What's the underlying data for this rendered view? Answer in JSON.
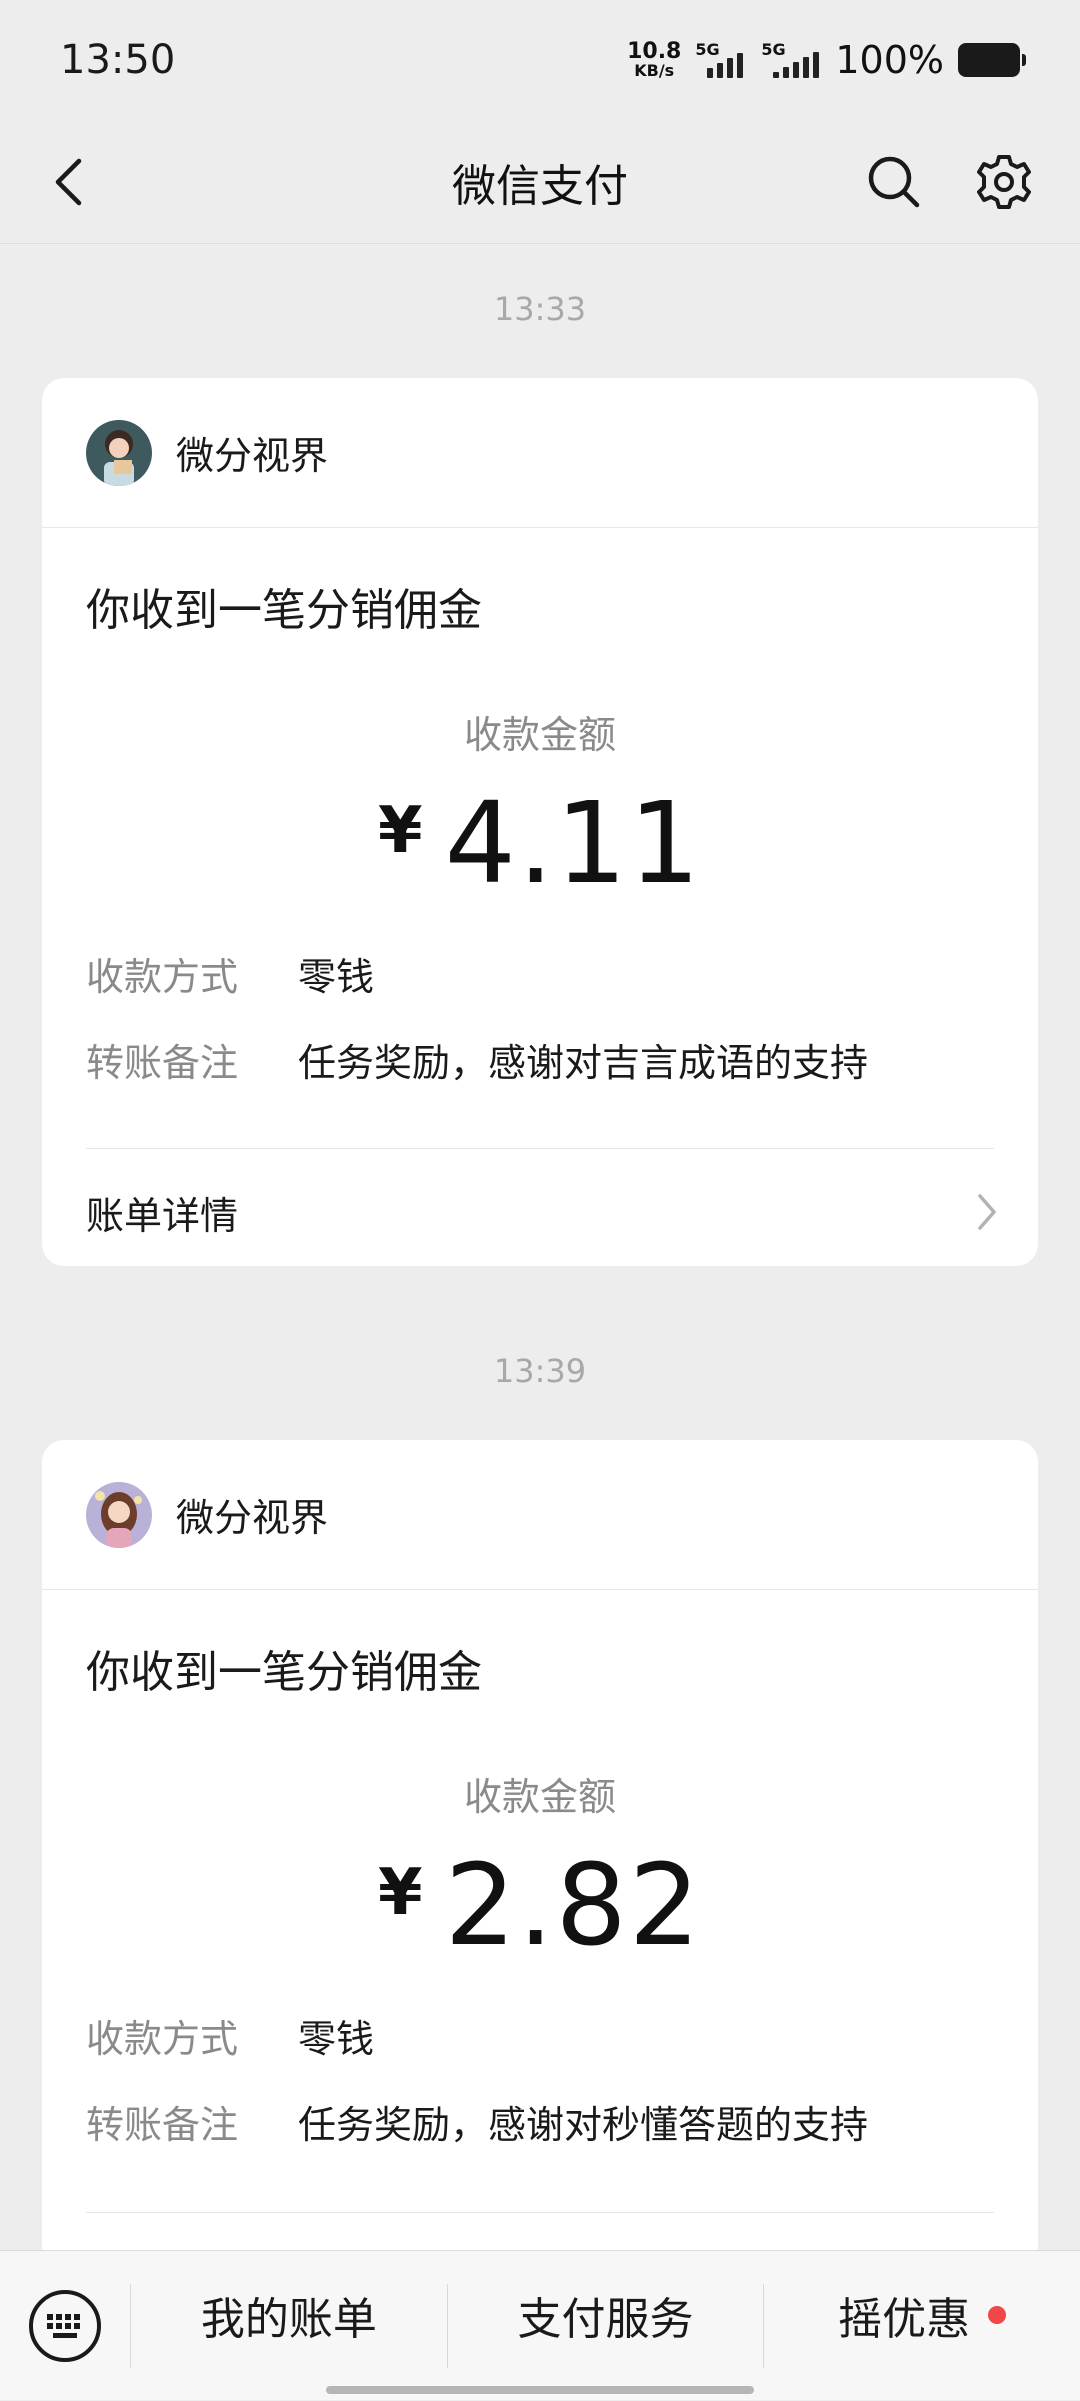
{
  "status_bar": {
    "time": "13:50",
    "net_speed": "10.8",
    "net_unit": "KB/s",
    "sim1_label": "5G",
    "sim2_label": "5G",
    "battery": "100%"
  },
  "header": {
    "title": "微信支付",
    "back_icon": "chevron-left-icon",
    "search_icon": "search-icon",
    "settings_icon": "gear-icon"
  },
  "messages": [
    {
      "time": "13:33",
      "sender": "微分视界",
      "title": "你收到一笔分销佣金",
      "amount_label": "收款金额",
      "currency": "¥",
      "amount": "4.11",
      "method_key": "收款方式",
      "method_value": "零钱",
      "note_key": "转账备注",
      "note_value": "任务奖励，感谢对吉言成语的支持",
      "detail_label": "账单详情"
    },
    {
      "time": "13:39",
      "sender": "微分视界",
      "title": "你收到一笔分销佣金",
      "amount_label": "收款金额",
      "currency": "¥",
      "amount": "2.82",
      "method_key": "收款方式",
      "method_value": "零钱",
      "note_key": "转账备注",
      "note_value": "任务奖励，感谢对秒懂答题的支持"
    }
  ],
  "bottom_menu": {
    "keyboard_icon": "keyboard-icon",
    "items": [
      "我的账单",
      "支付服务",
      "摇优惠"
    ]
  },
  "colors": {
    "background": "#ededed",
    "card": "#ffffff",
    "notification_dot": "#f04848"
  }
}
